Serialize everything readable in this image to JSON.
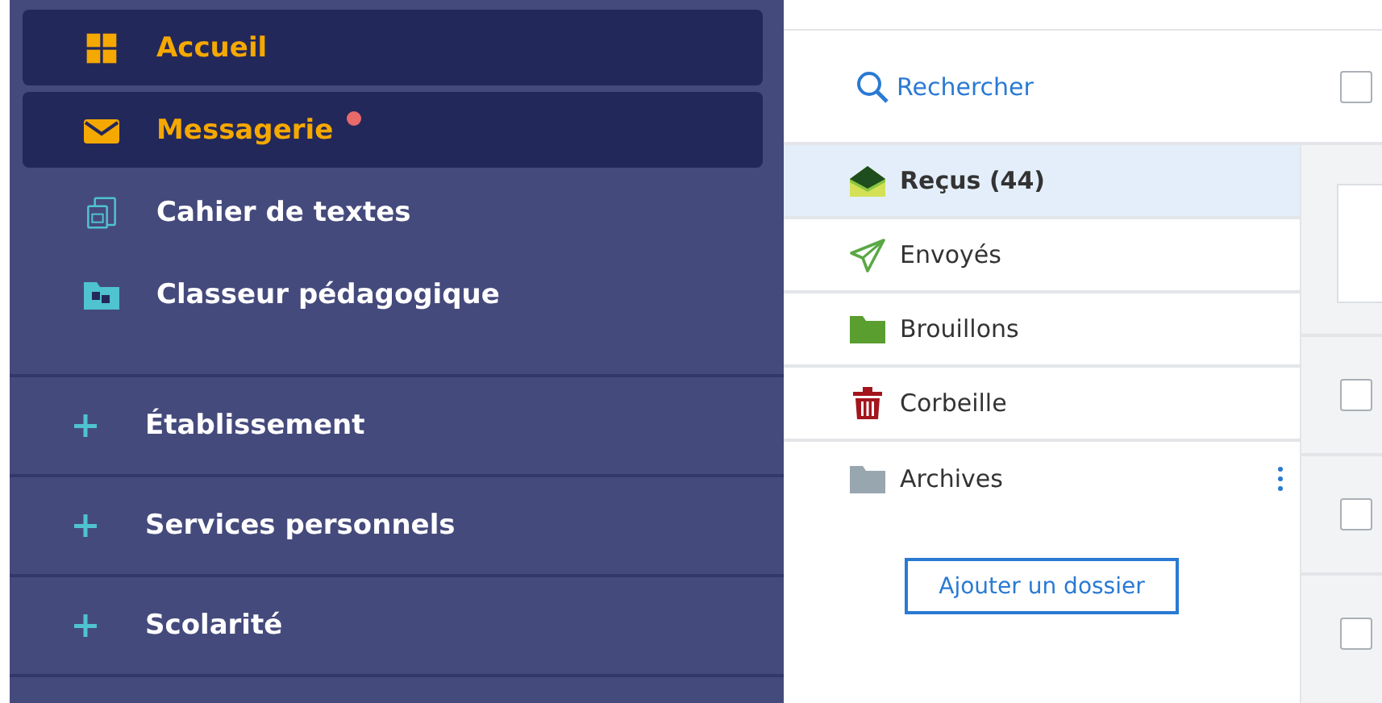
{
  "sidebar": {
    "items": [
      {
        "label": "Accueil",
        "kind": "grid",
        "selected": true,
        "unread": false
      },
      {
        "label": "Messagerie",
        "kind": "mail",
        "selected": true,
        "unread": true
      },
      {
        "label": "Cahier de textes",
        "kind": "calendar",
        "selected": false,
        "unread": false
      },
      {
        "label": "Classeur pédagogique",
        "kind": "folder",
        "selected": false,
        "unread": false
      }
    ],
    "sections": [
      {
        "label": "Établissement",
        "expanded": false
      },
      {
        "label": "Services personnels",
        "expanded": false
      },
      {
        "label": "Scolarité",
        "expanded": false
      }
    ]
  },
  "search": {
    "label": "Rechercher"
  },
  "select_all": {
    "checked": false
  },
  "folders": [
    {
      "label": "Reçus (44)",
      "kind": "inbox",
      "selected": true,
      "has_menu": false
    },
    {
      "label": "Envoyés",
      "kind": "sent",
      "selected": false,
      "has_menu": false
    },
    {
      "label": "Brouillons",
      "kind": "drafts",
      "selected": false,
      "has_menu": false
    },
    {
      "label": "Corbeille",
      "kind": "trash",
      "selected": false,
      "has_menu": false
    },
    {
      "label": "Archives",
      "kind": "archive",
      "selected": false,
      "has_menu": true
    }
  ],
  "add_folder_button": "Ajouter un dossier",
  "messages": [
    {
      "kind": "card"
    },
    {
      "kind": "row",
      "checked": false
    },
    {
      "kind": "row",
      "checked": false
    },
    {
      "kind": "row",
      "checked": false
    }
  ]
}
